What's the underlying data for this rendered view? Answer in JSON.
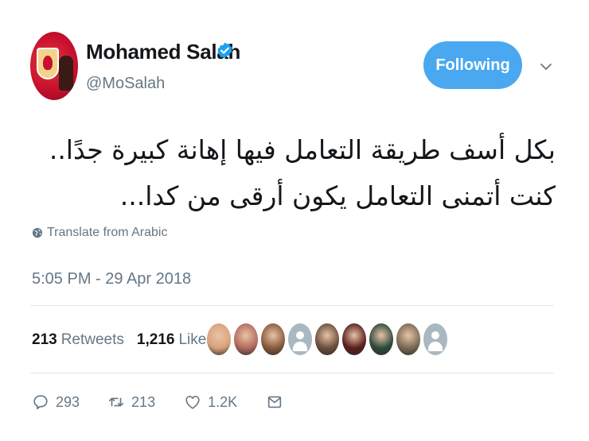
{
  "user": {
    "name": "Mohamed Salah",
    "handle": "@MoSalah",
    "follow_label": "Following"
  },
  "tweet": {
    "lines": [
      "بكل أسف طريقة التعامل فيها إهانة كبيرة جدًا..",
      "كنت أتمنى التعامل يكون أرقى من كدا..."
    ],
    "translate_label": "Translate from Arabic",
    "timestamp": "5:05 PM - 29 Apr 2018"
  },
  "stats": {
    "retweets_count": "213",
    "retweets_label": "Retweets",
    "likes_count": "1,216",
    "likes_label": "Likes"
  },
  "likers": [
    {
      "color": "#d9a27a"
    },
    {
      "color": "#b36a5e"
    },
    {
      "color": "#8a5a3c"
    },
    {
      "color": "#aab8c2",
      "default": true
    },
    {
      "color": "#6b4e3d"
    },
    {
      "color": "#5a1e1e"
    },
    {
      "color": "#2e4a3a"
    },
    {
      "color": "#7a6a55"
    },
    {
      "color": "#aab8c2",
      "default": true
    }
  ],
  "actions": {
    "reply_count": "293",
    "retweet_count": "213",
    "like_count": "1.2K"
  },
  "colors": {
    "accent": "#4aa8f0",
    "verified": "#1da1f2",
    "secondary_text": "#657786"
  }
}
